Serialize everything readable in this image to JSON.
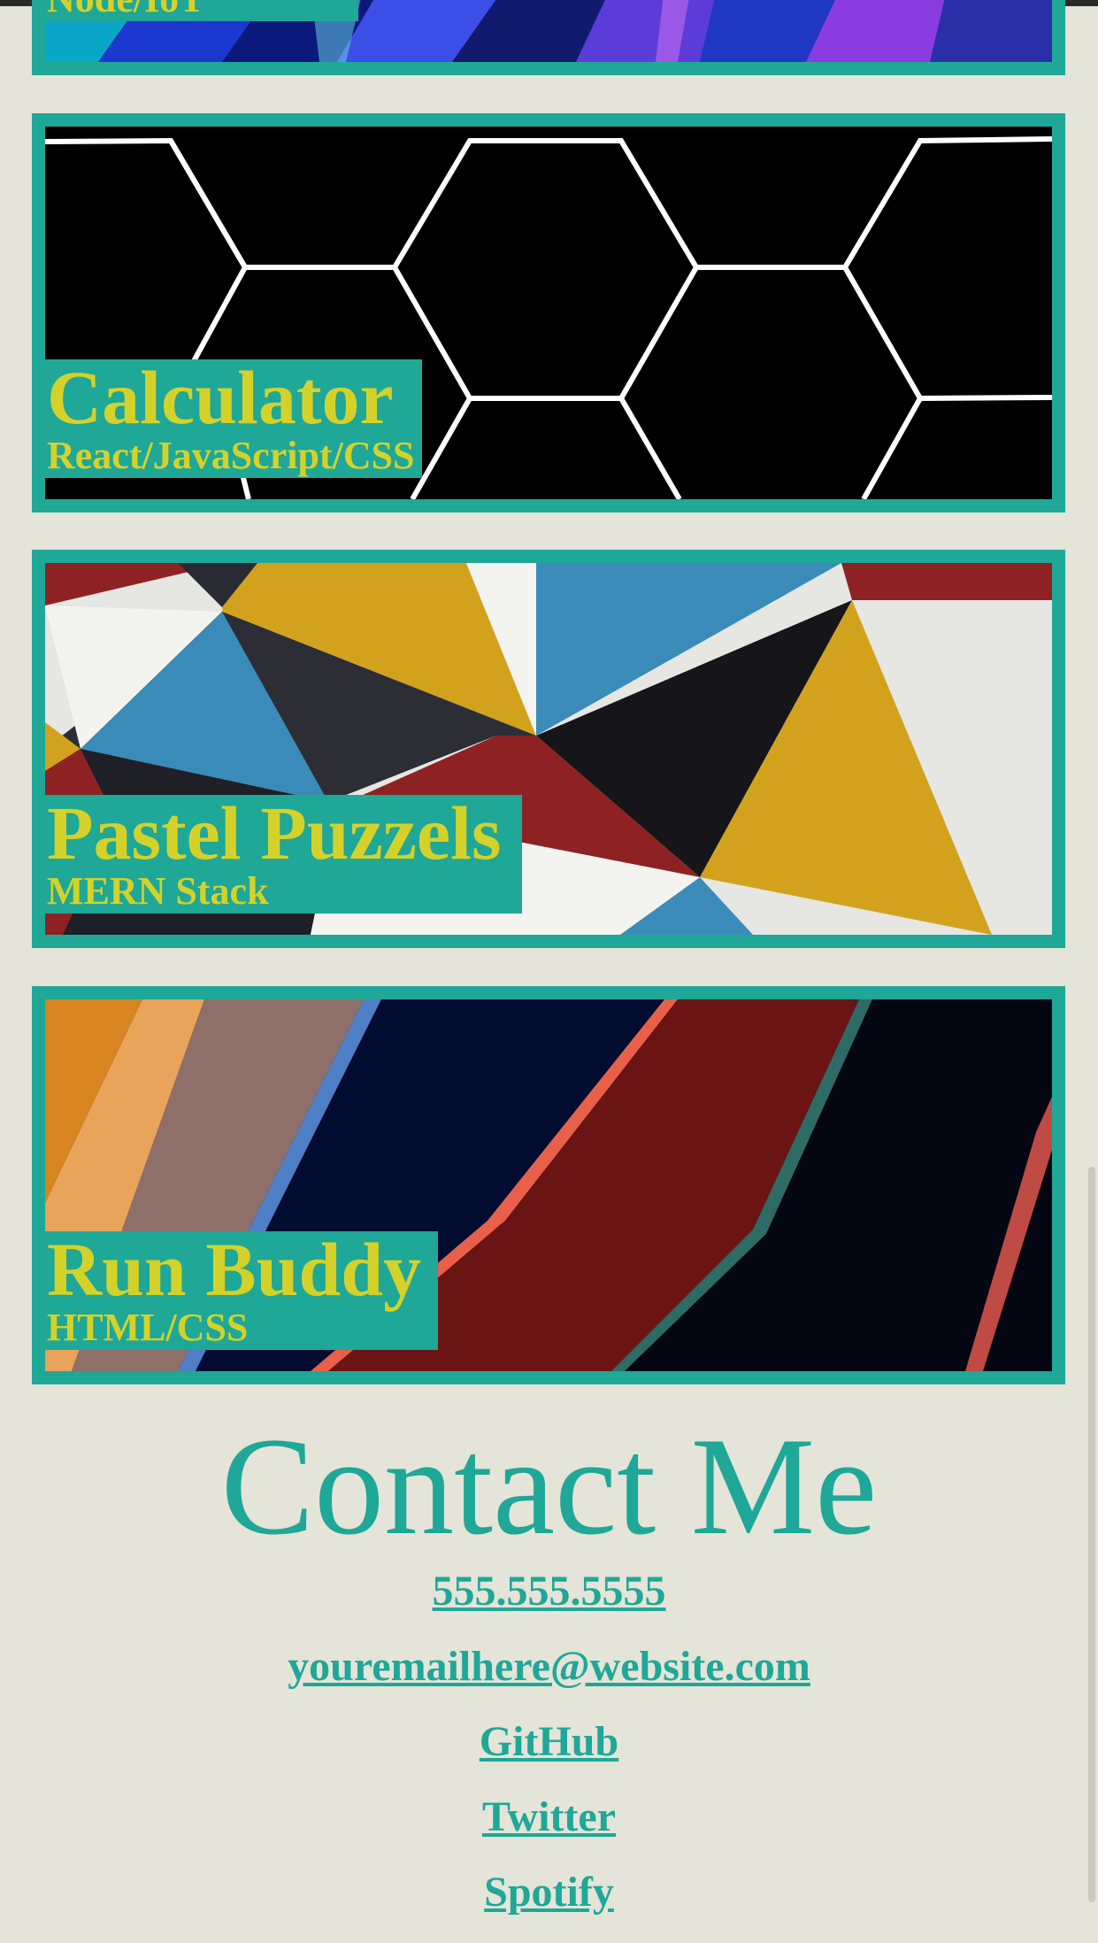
{
  "projects": [
    {
      "title": "",
      "stack": "Node/IoT"
    },
    {
      "title": "Calculator",
      "stack": "React/JavaScript/CSS"
    },
    {
      "title": "Pastel Puzzels",
      "stack": "MERN Stack"
    },
    {
      "title": "Run Buddy",
      "stack": "HTML/CSS"
    }
  ],
  "contact": {
    "heading": "Contact Me",
    "phone": "555.555.5555",
    "email": "youremailhere@website.com",
    "github": "GitHub",
    "twitter": "Twitter",
    "spotify": "Spotify"
  },
  "colors": {
    "page_background": "#e4e4d9",
    "accent_teal": "#1fa797",
    "caption_text": "#d4d22a"
  }
}
